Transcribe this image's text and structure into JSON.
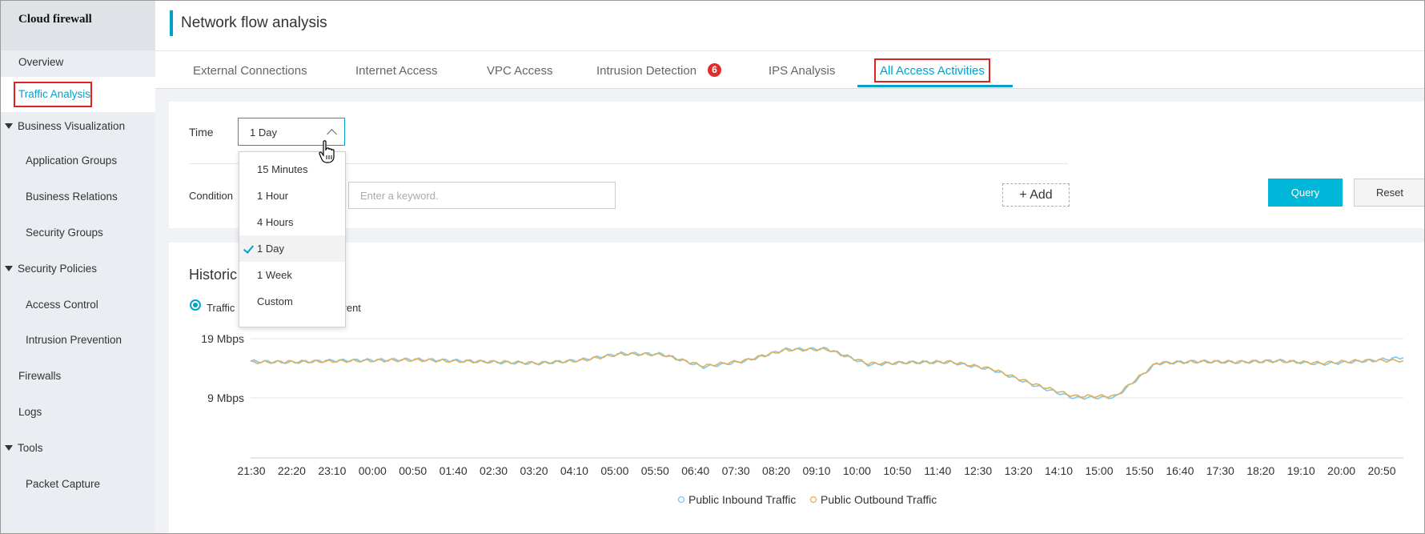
{
  "sidebar": {
    "brand": "Cloud firewall",
    "items": [
      {
        "label": "Overview"
      },
      {
        "label": "Traffic Analysis"
      },
      {
        "label": "Business Visualization"
      },
      {
        "label": "Application Groups"
      },
      {
        "label": "Business Relations"
      },
      {
        "label": "Security Groups"
      },
      {
        "label": "Security Policies"
      },
      {
        "label": "Access Control"
      },
      {
        "label": "Intrusion Prevention"
      },
      {
        "label": "Firewalls"
      },
      {
        "label": "Logs"
      },
      {
        "label": "Tools"
      },
      {
        "label": "Packet Capture"
      }
    ]
  },
  "header": {
    "title": "Network flow analysis"
  },
  "tabs": [
    {
      "label": "External Connections"
    },
    {
      "label": "Internet Access"
    },
    {
      "label": "VPC Access"
    },
    {
      "label": "Intrusion Detection",
      "badge": "6"
    },
    {
      "label": "IPS Analysis"
    },
    {
      "label": "All Access Activities",
      "active": true
    }
  ],
  "filters": {
    "time_label": "Time",
    "time_value": "1 Day",
    "condition_label": "Condition",
    "keyword_placeholder": "Enter a keyword.",
    "add_label": "+ Add",
    "query_label": "Query",
    "reset_label": "Reset",
    "time_options": [
      "15 Minutes",
      "1 Hour",
      "4 Hours",
      "1 Day",
      "1 Week",
      "Custom"
    ],
    "selected_option": "1 Day"
  },
  "history": {
    "title": "Historic",
    "radio_traffic": "Traffic",
    "radio_concurrent": "oncurrent"
  },
  "colors": {
    "accent": "#00a2ca",
    "inbound": "#7ec8f0",
    "outbound": "#e0b15a",
    "highlight": "#e2231a"
  },
  "chart_data": {
    "type": "line",
    "x": [
      "21:30",
      "22:20",
      "23:10",
      "00:00",
      "00:50",
      "01:40",
      "02:30",
      "03:20",
      "04:10",
      "05:00",
      "05:50",
      "06:40",
      "07:30",
      "08:20",
      "09:10",
      "10:00",
      "10:50",
      "11:40",
      "12:30",
      "13:20",
      "14:10",
      "15:00",
      "15:50",
      "16:40",
      "17:30",
      "18:20",
      "19:10",
      "20:00",
      "20:50"
    ],
    "yticks": [
      "19 Mbps",
      "9 Mbps"
    ],
    "series": [
      {
        "name": "Public Inbound Traffic",
        "values": [
          15.2,
          15.0,
          15.3,
          15.4,
          15.5,
          15.3,
          15.0,
          14.8,
          15.4,
          16.5,
          16.4,
          14.2,
          15.2,
          17.2,
          17.3,
          14.6,
          15.0,
          15.0,
          13.8,
          11.2,
          9.0,
          9.1,
          14.8,
          15.2,
          15.0,
          15.3,
          14.7,
          15.2,
          15.8
        ]
      },
      {
        "name": "Public Outbound Traffic",
        "values": [
          15.0,
          15.1,
          15.2,
          15.3,
          15.4,
          15.2,
          15.1,
          14.9,
          15.3,
          16.4,
          16.3,
          14.4,
          15.3,
          17.1,
          17.2,
          14.8,
          15.0,
          15.1,
          13.9,
          11.4,
          9.3,
          9.3,
          14.9,
          15.1,
          15.1,
          15.2,
          14.9,
          15.3,
          15.3
        ]
      }
    ]
  }
}
